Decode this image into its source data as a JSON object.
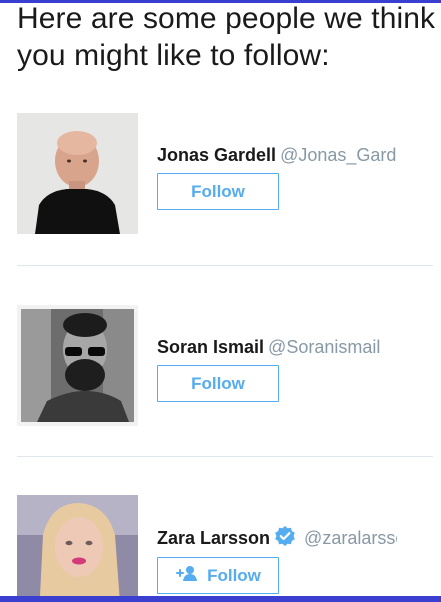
{
  "heading": "Here are some people we think you might like to follow:",
  "colors": {
    "accent": "#55acee",
    "divider": "#e1e8ed",
    "handle": "#8899a6",
    "bar": "#3a3fcf"
  },
  "people": [
    {
      "name": "Jonas Gardell",
      "handle": "@Jonas_Gardell",
      "verified": false,
      "follow_label": "Follow",
      "follow_icon": null
    },
    {
      "name": "Soran Ismail",
      "handle": "@Soranismail",
      "verified": false,
      "follow_label": "Follow",
      "follow_icon": null
    },
    {
      "name": "Zara Larsson",
      "handle": "@zaralarsson",
      "verified": true,
      "follow_label": "Follow",
      "follow_icon": "add-user-icon"
    }
  ]
}
